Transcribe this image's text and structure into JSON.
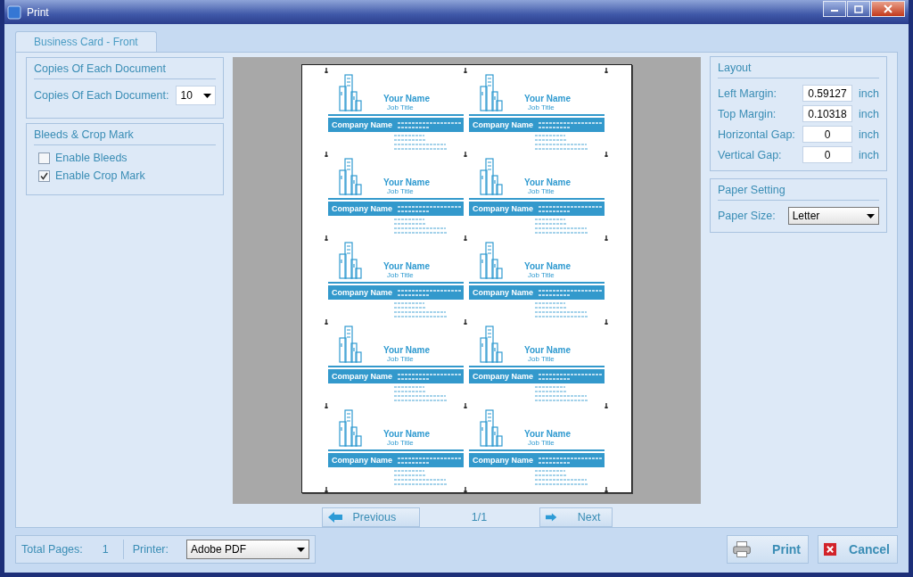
{
  "window": {
    "title": "Print"
  },
  "tabs": [
    {
      "label": "Business Card - Front",
      "selected": true
    }
  ],
  "copies": {
    "title": "Copies Of Each Document",
    "label": "Copies Of Each Document:",
    "value": "10"
  },
  "bleeds": {
    "title": "Bleeds & Crop Mark",
    "options": [
      {
        "label": "Enable Bleeds",
        "checked": false
      },
      {
        "label": "Enable Crop Mark",
        "checked": true
      }
    ]
  },
  "preview": {
    "cards": [
      {
        "name": "Your Name",
        "job": "Job Title",
        "company": "Company Name"
      },
      {
        "name": "Your Name",
        "job": "Job Title",
        "company": "Company Name"
      },
      {
        "name": "Your Name",
        "job": "Job Title",
        "company": "Company Name"
      },
      {
        "name": "Your Name",
        "job": "Job Title",
        "company": "Company Name"
      },
      {
        "name": "Your Name",
        "job": "Job Title",
        "company": "Company Name"
      },
      {
        "name": "Your Name",
        "job": "Job Title",
        "company": "Company Name"
      },
      {
        "name": "Your Name",
        "job": "Job Title",
        "company": "Company Name"
      },
      {
        "name": "Your Name",
        "job": "Job Title",
        "company": "Company Name"
      },
      {
        "name": "Your Name",
        "job": "Job Title",
        "company": "Company Name"
      },
      {
        "name": "Your Name",
        "job": "Job Title",
        "company": "Company Name"
      }
    ],
    "previous": "Previous",
    "page": "1/1",
    "next": "Next"
  },
  "layout": {
    "title": "Layout",
    "fields": [
      {
        "label": "Left Margin:",
        "value": "0.59127",
        "unit": "inch"
      },
      {
        "label": "Top Margin:",
        "value": "0.10318",
        "unit": "inch"
      },
      {
        "label": "Horizontal Gap:",
        "value": "0",
        "unit": "inch"
      },
      {
        "label": "Vertical Gap:",
        "value": "0",
        "unit": "inch"
      }
    ]
  },
  "paper": {
    "title": "Paper Setting",
    "label": "Paper Size:",
    "value": "Letter"
  },
  "status": {
    "total_label": "Total Pages:",
    "total": "1",
    "printer_label": "Printer:",
    "printer": "Adobe PDF"
  },
  "buttons": [
    {
      "label": "Print",
      "kind": "print"
    },
    {
      "label": "Cancel",
      "kind": "cancel"
    }
  ]
}
